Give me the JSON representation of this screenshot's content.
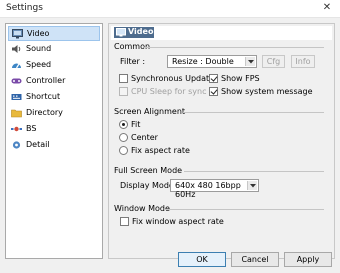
{
  "window": {
    "title": "Settings",
    "close_glyph": "✕"
  },
  "sidebar": {
    "items": [
      {
        "label": "Video",
        "icon": "video-icon",
        "selected": true
      },
      {
        "label": "Sound",
        "icon": "speaker-icon"
      },
      {
        "label": "Speed",
        "icon": "speed-icon"
      },
      {
        "label": "Controller",
        "icon": "controller-icon"
      },
      {
        "label": "Shortcut",
        "icon": "keyboard-icon"
      },
      {
        "label": "Directory",
        "icon": "folder-icon"
      },
      {
        "label": "BS",
        "icon": "satellite-icon"
      },
      {
        "label": "Detail",
        "icon": "gear-icon"
      }
    ]
  },
  "panel": {
    "title": "Video",
    "common": {
      "title": "Common",
      "filter_label": "Filter :",
      "filter_value": "Resize : Double",
      "cfg_label": "Cfg",
      "info_label": "Info",
      "synchronous_update": {
        "label": "Synchronous Update",
        "checked": false
      },
      "show_fps": {
        "label": "Show FPS",
        "checked": true
      },
      "cpu_sleep": {
        "label": "CPU Sleep for sync",
        "checked": false,
        "disabled": true
      },
      "show_system_message": {
        "label": "Show system message",
        "checked": true
      }
    },
    "screen_alignment": {
      "title": "Screen Alignment",
      "options": [
        {
          "label": "Fit",
          "checked": true
        },
        {
          "label": "Center",
          "checked": false
        },
        {
          "label": "Fix aspect rate",
          "checked": false
        }
      ]
    },
    "full_screen_mode": {
      "title": "Full Screen Mode",
      "display_mode_label": "Display Mode :",
      "display_mode_value": "640x  480 16bpp 60Hz"
    },
    "window_mode": {
      "title": "Window Mode",
      "fix_window_aspect_rate": {
        "label": "Fix window aspect rate",
        "checked": false
      }
    }
  },
  "buttons": {
    "ok": "OK",
    "cancel": "Cancel",
    "apply": "Apply"
  },
  "colors": {
    "selection_bg": "#cfe3f7",
    "header_band": "#4e6c8e",
    "default_button_border": "#3c7fb1"
  }
}
